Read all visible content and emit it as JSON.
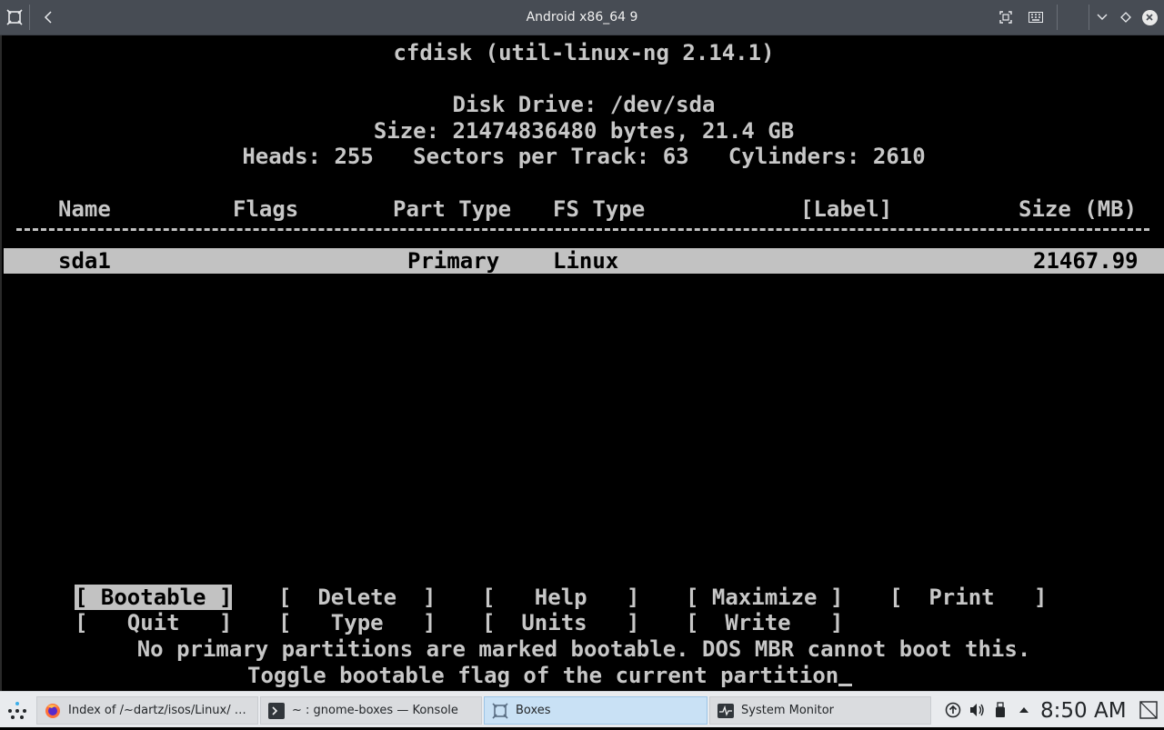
{
  "window": {
    "title": "Android x86_64 9"
  },
  "titlebar_icons": {
    "app": "boxes-icon",
    "back": "chevron-left-icon",
    "fullscreen": "fullscreen-icon",
    "keyboard": "keyboard-icon",
    "menu": "chevron-down-icon",
    "diamond": "diamond-icon",
    "close": "close-icon"
  },
  "console": {
    "header": "cfdisk (util-linux-ng 2.14.1)",
    "disk_drive": "Disk Drive: /dev/sda",
    "size_line": "Size: 21474836480 bytes, 21.4 GB",
    "geometry": "Heads: 255   Sectors per Track: 63   Cylinders: 2610",
    "columns": {
      "name": "Name",
      "flags": "Flags",
      "part_type": "Part Type",
      "fs_type": "FS Type",
      "label": "[Label]",
      "size": "Size (MB)"
    },
    "rows": [
      {
        "name": "sda1",
        "flags": "",
        "part_type": "Primary",
        "fs_type": "Linux",
        "label": "",
        "size": "21467.99"
      }
    ],
    "menu": [
      "[ Bootable ]",
      "[  Delete  ]",
      "[   Help   ]",
      "[ Maximize ]",
      "[  Print   ]",
      "[   Quit   ]",
      "[   Type   ]",
      "[  Units   ]",
      "[  Write   ]"
    ],
    "warning": "No primary partitions are marked bootable. DOS MBR cannot boot this.",
    "hint": "Toggle bootable flag of the current partition"
  },
  "taskbar": {
    "tasks": [
      {
        "label": "Index of /~dartz/isos/Linux/ — ...",
        "icon": "firefox-icon"
      },
      {
        "label": "~ : gnome-boxes — Konsole",
        "icon": "terminal-icon"
      },
      {
        "label": "Boxes",
        "icon": "boxes-icon"
      },
      {
        "label": "System Monitor",
        "icon": "system-monitor-icon"
      }
    ],
    "tray": [
      "update-icon",
      "volume-icon",
      "usb-icon",
      "chevron-up-icon"
    ],
    "clock": "8:50 AM",
    "colors": {
      "active_task": "#c9e1f5",
      "panel": "#e9ebee"
    }
  }
}
